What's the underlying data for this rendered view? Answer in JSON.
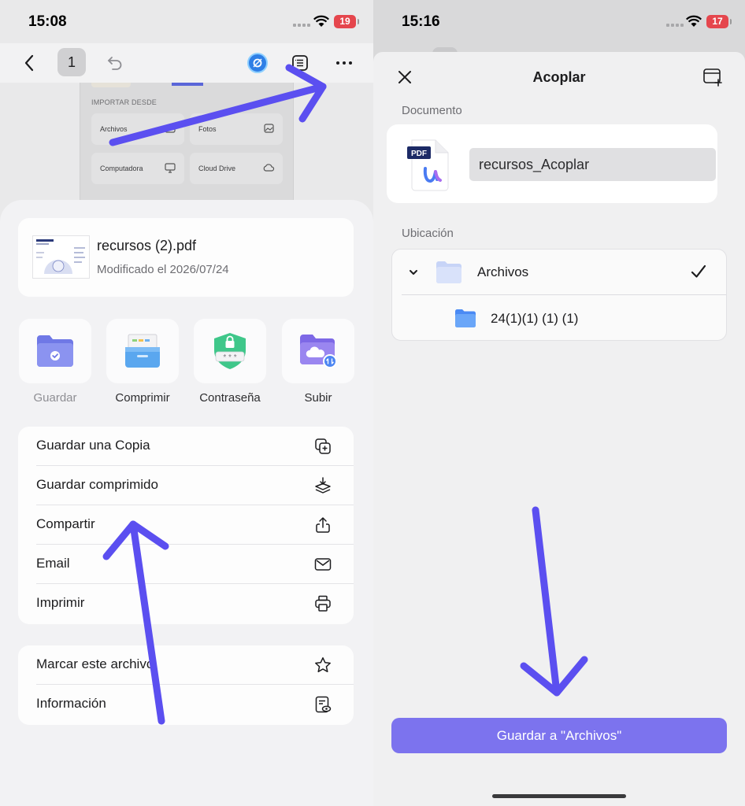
{
  "left_screen": {
    "status": {
      "time": "15:08",
      "battery": "19",
      "battery_color": "#e5464d"
    },
    "toolbar": {
      "page_number": "1",
      "icons": [
        "back-icon",
        "undo-icon",
        "ai-assistant-icon",
        "outline-icon",
        "more-icon"
      ]
    },
    "background_doc": {
      "section_title": "IMPORTAR DESDE",
      "tiles": [
        {
          "label": "Archivos",
          "icon": "import-icon"
        },
        {
          "label": "Fotos",
          "icon": "photos-icon"
        },
        {
          "label": "Computadora",
          "icon": "computer-icon"
        },
        {
          "label": "Cloud Drive",
          "icon": "cloud-icon"
        }
      ]
    },
    "sheet": {
      "file": {
        "name": "recursos (2).pdf",
        "modified": "Modificado el 2026/07/24"
      },
      "quick_actions": [
        {
          "label": "Guardar",
          "icon": "save-folder-icon"
        },
        {
          "label": "Comprimir",
          "icon": "compress-icon"
        },
        {
          "label": "Contraseña",
          "icon": "password-shield-icon"
        },
        {
          "label": "Subir",
          "icon": "upload-cloud-icon"
        }
      ],
      "menu_group_1": [
        {
          "label": "Guardar una Copia",
          "icon": "copy-plus-icon"
        },
        {
          "label": "Guardar comprimido",
          "icon": "compressed-layers-icon"
        },
        {
          "label": "Compartir",
          "icon": "share-icon"
        },
        {
          "label": "Email",
          "icon": "mail-icon"
        },
        {
          "label": "Imprimir",
          "icon": "printer-icon"
        }
      ],
      "menu_group_2": [
        {
          "label": "Marcar este archivo",
          "icon": "star-icon"
        },
        {
          "label": "Información",
          "icon": "info-doc-icon"
        }
      ]
    }
  },
  "right_screen": {
    "status": {
      "time": "15:16",
      "battery": "17",
      "battery_color": "#e5464d"
    },
    "title": "Acoplar",
    "document_section": "Documento",
    "document_badge": "PDF",
    "file_name_value": "recursos_Acoplar",
    "location_section": "Ubicación",
    "locations": [
      {
        "label": "Archivos",
        "selected": true
      },
      {
        "label": "24(1)(1) (1) (1)",
        "selected": false
      }
    ],
    "save_button": "Guardar a \"Archivos\"",
    "accent_color": "#7c73ee"
  },
  "annotation_arrow_color": "#5b4ff0"
}
